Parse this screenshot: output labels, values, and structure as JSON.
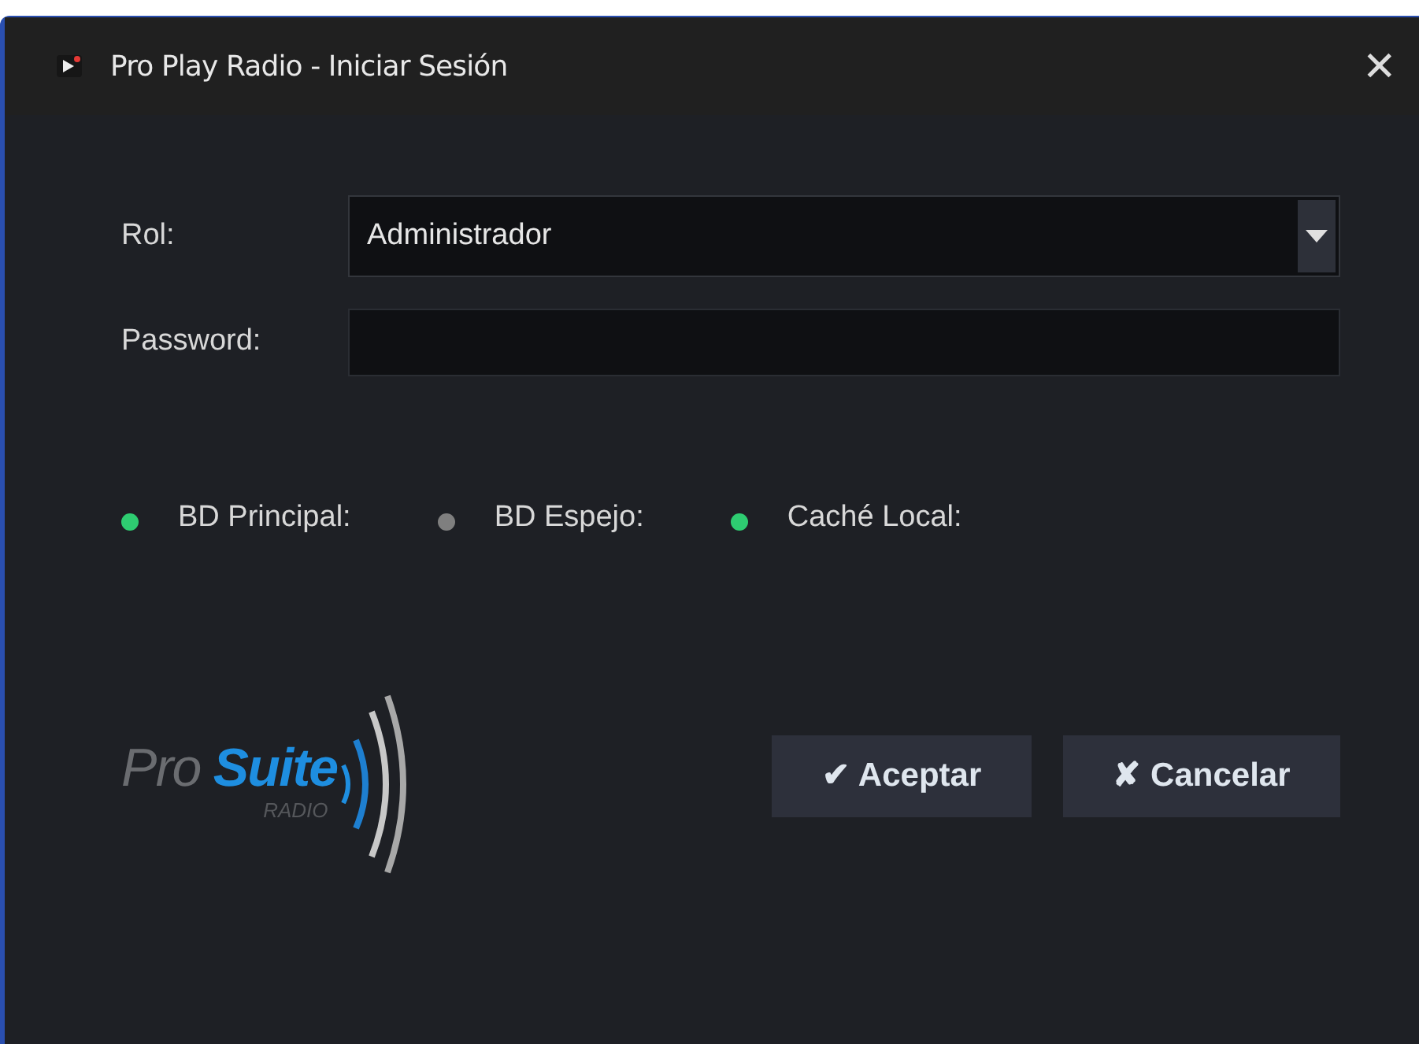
{
  "window": {
    "title": "Pro Play Radio - Iniciar Sesión",
    "close": "✕"
  },
  "form": {
    "role": {
      "label": "Rol:",
      "value": "Administrador"
    },
    "password": {
      "label": "Password:"
    }
  },
  "status": [
    {
      "label": "BD Principal:",
      "color": "#2ecc71"
    },
    {
      "label": "BD Espejo:",
      "color": "#7f7f7f"
    },
    {
      "label": "Caché Local:",
      "color": "#2ecc71"
    }
  ],
  "logo": {
    "word_1": "Pro",
    "word_2": "Suite",
    "tagline": "RADIO"
  },
  "buttons": [
    {
      "label": "✔ Aceptar"
    },
    {
      "label": "✘ Cancelar"
    }
  ]
}
